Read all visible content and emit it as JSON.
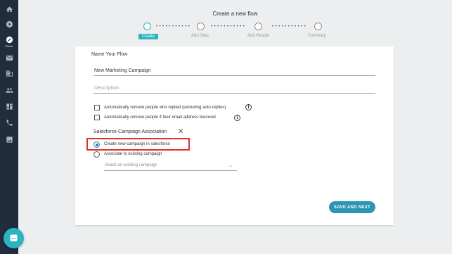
{
  "sidebar": {
    "items": [
      {
        "icon": "home-icon"
      },
      {
        "icon": "play-circle-icon"
      },
      {
        "icon": "flows-icon",
        "label": "Flows"
      },
      {
        "icon": "mail-icon"
      },
      {
        "icon": "building-icon"
      },
      {
        "icon": "people-icon"
      },
      {
        "icon": "dashboard-icon"
      },
      {
        "icon": "phone-icon"
      },
      {
        "icon": "image-icon"
      }
    ]
  },
  "header": {
    "title": "Create a new flow"
  },
  "stepper": {
    "steps": [
      {
        "label": "Create",
        "active": true
      },
      {
        "label": "Add Step",
        "active": false
      },
      {
        "label": "Add People",
        "active": false
      },
      {
        "label": "Summary",
        "active": false
      }
    ],
    "dots": "• • • • • • • • • • •"
  },
  "form": {
    "name_section_title": "Name Your Flow",
    "name_value": "New Marketing Campaign",
    "description_placeholder": "Description",
    "checkbox_replied": "Automatically remove people who replied (excluding auto-replies)",
    "checkbox_bounced": "Automatically remove people if their email address bounced",
    "salesforce_title": "Salesforce Campaign Association",
    "radio_create": "Create new campaign in salesforce",
    "radio_associate": "Associate to existing campaign",
    "select_placeholder": "Select an existing campaign",
    "save_button": "SAVE AND NEXT"
  },
  "colors": {
    "sidebar_bg": "#1f2d3d",
    "accent": "#2bb3c0",
    "button": "#2b95b3",
    "highlight": "#e0302b"
  }
}
